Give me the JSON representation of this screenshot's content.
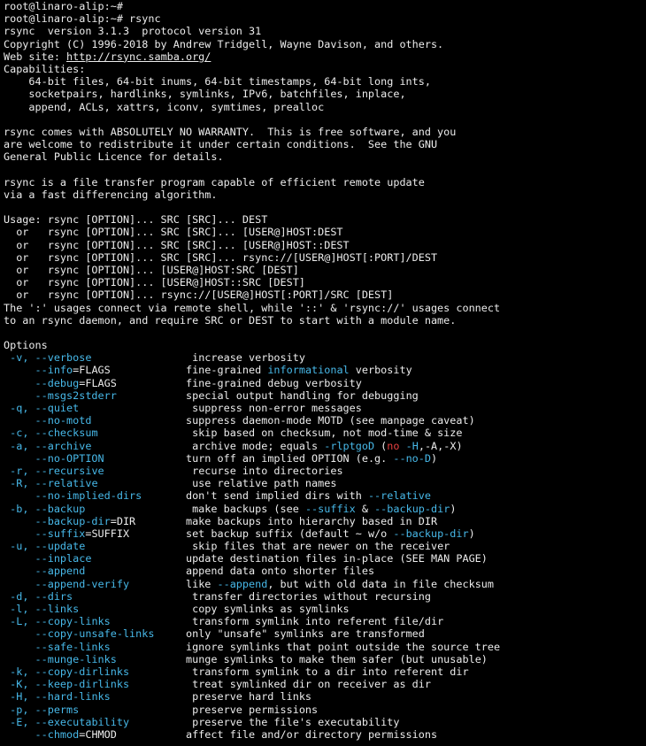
{
  "terminal": {
    "lines": [
      [
        {
          "t": "root@linaro-alip:~#"
        }
      ],
      [
        {
          "t": "root@linaro-alip:~# rsync"
        }
      ],
      [
        {
          "t": "rsync  version 3.1.3  protocol version 31"
        }
      ],
      [
        {
          "t": "Copyright (C) 1996-2018 by Andrew Tridgell, Wayne Davison, and others."
        }
      ],
      [
        {
          "t": "Web site: "
        },
        {
          "t": "http://rsync.samba.org/",
          "c": "link"
        }
      ],
      [
        {
          "t": "Capabilities:"
        }
      ],
      [
        {
          "t": "    64-bit files, 64-bit inums, 64-bit timestamps, 64-bit long ints,"
        }
      ],
      [
        {
          "t": "    socketpairs, hardlinks, symlinks, IPv6, batchfiles, inplace,"
        }
      ],
      [
        {
          "t": "    append, ACLs, xattrs, iconv, symtimes, prealloc"
        }
      ],
      [
        {
          "t": ""
        }
      ],
      [
        {
          "t": "rsync comes with ABSOLUTELY NO WARRANTY.  This is free software, and you"
        }
      ],
      [
        {
          "t": "are welcome to redistribute it under certain conditions.  See the GNU"
        }
      ],
      [
        {
          "t": "General Public Licence for details."
        }
      ],
      [
        {
          "t": ""
        }
      ],
      [
        {
          "t": "rsync is a file transfer program capable of efficient remote update"
        }
      ],
      [
        {
          "t": "via a fast differencing algorithm."
        }
      ],
      [
        {
          "t": ""
        }
      ],
      [
        {
          "t": "Usage: rsync [OPTION]... SRC [SRC]... DEST"
        }
      ],
      [
        {
          "t": "  or   rsync [OPTION]... SRC [SRC]... [USER@]HOST:DEST"
        }
      ],
      [
        {
          "t": "  or   rsync [OPTION]... SRC [SRC]... [USER@]HOST::DEST"
        }
      ],
      [
        {
          "t": "  or   rsync [OPTION]... SRC [SRC]... rsync://[USER@]HOST[:PORT]/DEST"
        }
      ],
      [
        {
          "t": "  or   rsync [OPTION]... [USER@]HOST:SRC [DEST]"
        }
      ],
      [
        {
          "t": "  or   rsync [OPTION]... [USER@]HOST::SRC [DEST]"
        }
      ],
      [
        {
          "t": "  or   rsync [OPTION]... rsync://[USER@]HOST[:PORT]/SRC [DEST]"
        }
      ],
      [
        {
          "t": "The ':' usages connect via remote shell, while '::' & 'rsync://' usages connect"
        }
      ],
      [
        {
          "t": "to an rsync daemon, and require SRC or DEST to start with a module name."
        }
      ],
      [
        {
          "t": ""
        }
      ],
      [
        {
          "t": "Options"
        }
      ],
      [
        {
          "t": " "
        },
        {
          "t": "-v, --verbose",
          "c": "hl"
        },
        {
          "t": "                increase verbosity"
        }
      ],
      [
        {
          "t": "     "
        },
        {
          "t": "--info",
          "c": "hl"
        },
        {
          "t": "=FLAGS            fine-grained "
        },
        {
          "t": "informational",
          "c": "hl"
        },
        {
          "t": " verbosity"
        }
      ],
      [
        {
          "t": "     "
        },
        {
          "t": "--debug",
          "c": "hl"
        },
        {
          "t": "=FLAGS           fine-grained debug verbosity"
        }
      ],
      [
        {
          "t": "     "
        },
        {
          "t": "--msgs2stderr",
          "c": "hl"
        },
        {
          "t": "           special output handling for debugging"
        }
      ],
      [
        {
          "t": " "
        },
        {
          "t": "-q, --quiet",
          "c": "hl"
        },
        {
          "t": "                  suppress non-error messages"
        }
      ],
      [
        {
          "t": "     "
        },
        {
          "t": "--no-motd",
          "c": "hl"
        },
        {
          "t": "               suppress daemon-mode MOTD (see manpage caveat)"
        }
      ],
      [
        {
          "t": " "
        },
        {
          "t": "-c, --checksum",
          "c": "hl"
        },
        {
          "t": "               skip based on checksum, not mod-time & size"
        }
      ],
      [
        {
          "t": " "
        },
        {
          "t": "-a, --archive",
          "c": "hl"
        },
        {
          "t": "                archive mode; equals "
        },
        {
          "t": "-rlptgoD",
          "c": "hl"
        },
        {
          "t": " ("
        },
        {
          "t": "no",
          "c": "red"
        },
        {
          "t": " "
        },
        {
          "t": "-H",
          "c": "hl"
        },
        {
          "t": ",-A,-X)"
        }
      ],
      [
        {
          "t": "     "
        },
        {
          "t": "--no-OPTION",
          "c": "hl"
        },
        {
          "t": "             turn off an implied OPTION (e.g. "
        },
        {
          "t": "--no-D",
          "c": "hl"
        },
        {
          "t": ")"
        }
      ],
      [
        {
          "t": " "
        },
        {
          "t": "-r, --recursive",
          "c": "hl"
        },
        {
          "t": "              recurse into directories"
        }
      ],
      [
        {
          "t": " "
        },
        {
          "t": "-R, --relative",
          "c": "hl"
        },
        {
          "t": "               use relative path names"
        }
      ],
      [
        {
          "t": "     "
        },
        {
          "t": "--no-implied-dirs",
          "c": "hl"
        },
        {
          "t": "       don't send implied dirs with "
        },
        {
          "t": "--relative",
          "c": "hl"
        }
      ],
      [
        {
          "t": " "
        },
        {
          "t": "-b, --backup",
          "c": "hl"
        },
        {
          "t": "                 make backups (see "
        },
        {
          "t": "--suffix",
          "c": "hl"
        },
        {
          "t": " & "
        },
        {
          "t": "--backup-dir",
          "c": "hl"
        },
        {
          "t": ")"
        }
      ],
      [
        {
          "t": "     "
        },
        {
          "t": "--backup-dir",
          "c": "hl"
        },
        {
          "t": "=DIR        make backups into hierarchy based in DIR"
        }
      ],
      [
        {
          "t": "     "
        },
        {
          "t": "--suffix",
          "c": "hl"
        },
        {
          "t": "=SUFFIX         set backup suffix (default ~ w/o "
        },
        {
          "t": "--backup-dir",
          "c": "hl"
        },
        {
          "t": ")"
        }
      ],
      [
        {
          "t": " "
        },
        {
          "t": "-u, --update",
          "c": "hl"
        },
        {
          "t": "                 skip files that are newer on the receiver"
        }
      ],
      [
        {
          "t": "     "
        },
        {
          "t": "--inplace",
          "c": "hl"
        },
        {
          "t": "               update destination files in-place (SEE MAN PAGE)"
        }
      ],
      [
        {
          "t": "     "
        },
        {
          "t": "--append",
          "c": "hl"
        },
        {
          "t": "                append data onto shorter files"
        }
      ],
      [
        {
          "t": "     "
        },
        {
          "t": "--append-verify",
          "c": "hl"
        },
        {
          "t": "         like "
        },
        {
          "t": "--append",
          "c": "hl"
        },
        {
          "t": ", but with old data in file checksum"
        }
      ],
      [
        {
          "t": " "
        },
        {
          "t": "-d, --dirs",
          "c": "hl"
        },
        {
          "t": "                   transfer directories without recursing"
        }
      ],
      [
        {
          "t": " "
        },
        {
          "t": "-l, --links",
          "c": "hl"
        },
        {
          "t": "                  copy symlinks as symlinks"
        }
      ],
      [
        {
          "t": " "
        },
        {
          "t": "-L, --copy-links",
          "c": "hl"
        },
        {
          "t": "             transform symlink into referent file/dir"
        }
      ],
      [
        {
          "t": "     "
        },
        {
          "t": "--copy-unsafe-links",
          "c": "hl"
        },
        {
          "t": "     only \"unsafe\" symlinks are transformed"
        }
      ],
      [
        {
          "t": "     "
        },
        {
          "t": "--safe-links",
          "c": "hl"
        },
        {
          "t": "            ignore symlinks that point outside the source tree"
        }
      ],
      [
        {
          "t": "     "
        },
        {
          "t": "--munge-links",
          "c": "hl"
        },
        {
          "t": "           munge symlinks to make them safer (but unusable)"
        }
      ],
      [
        {
          "t": " "
        },
        {
          "t": "-k, --copy-dirlinks",
          "c": "hl"
        },
        {
          "t": "          transform symlink to a dir into referent dir"
        }
      ],
      [
        {
          "t": " "
        },
        {
          "t": "-K, --keep-dirlinks",
          "c": "hl"
        },
        {
          "t": "          treat symlinked dir on receiver as dir"
        }
      ],
      [
        {
          "t": " "
        },
        {
          "t": "-H, --hard-links",
          "c": "hl"
        },
        {
          "t": "             preserve hard links"
        }
      ],
      [
        {
          "t": " "
        },
        {
          "t": "-p, --perms",
          "c": "hl"
        },
        {
          "t": "                  preserve permissions"
        }
      ],
      [
        {
          "t": " "
        },
        {
          "t": "-E, --executability",
          "c": "hl"
        },
        {
          "t": "          preserve the file's executability"
        }
      ],
      [
        {
          "t": "     "
        },
        {
          "t": "--chmod",
          "c": "hl"
        },
        {
          "t": "=CHMOD           affect file and/or directory permissions"
        }
      ]
    ]
  }
}
